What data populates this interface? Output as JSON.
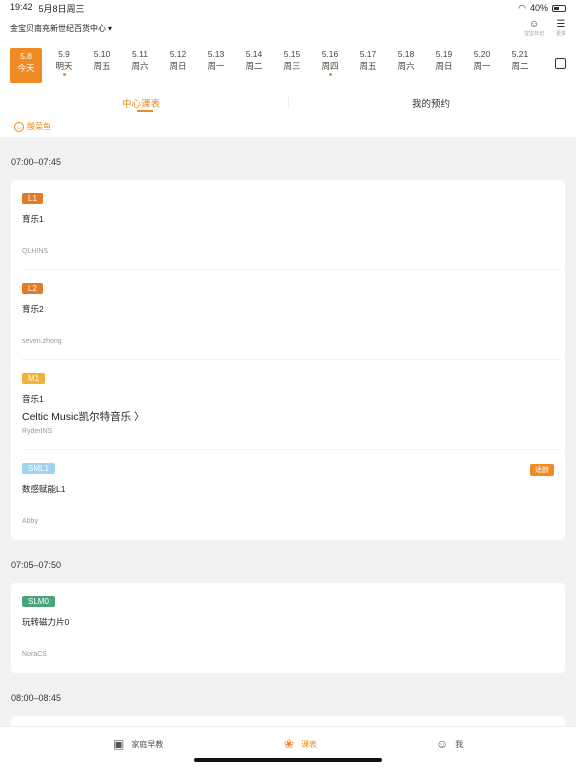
{
  "status": {
    "time": "19:42",
    "date": "5月8日周三",
    "battery": "40%"
  },
  "header": {
    "store": "金宝贝南充新世纪百货中心",
    "diary_label": "宝宝日记",
    "more_label": "更多"
  },
  "dates": [
    {
      "d": "5.8",
      "w": "今天",
      "active": true,
      "dot": false
    },
    {
      "d": "5.9",
      "w": "明天",
      "dot": true
    },
    {
      "d": "5.10",
      "w": "周五"
    },
    {
      "d": "5.11",
      "w": "周六"
    },
    {
      "d": "5.12",
      "w": "周日"
    },
    {
      "d": "5.13",
      "w": "周一"
    },
    {
      "d": "5.14",
      "w": "周二"
    },
    {
      "d": "5.15",
      "w": "周三"
    },
    {
      "d": "5.16",
      "w": "周四",
      "dot": true
    },
    {
      "d": "5.17",
      "w": "周五"
    },
    {
      "d": "5.18",
      "w": "周六"
    },
    {
      "d": "5.19",
      "w": "周日"
    },
    {
      "d": "5.20",
      "w": "周一"
    },
    {
      "d": "5.21",
      "w": "周二"
    }
  ],
  "tabs": {
    "center": "中心课表",
    "mine": "我的预约"
  },
  "filter": {
    "child": "酸菜鱼"
  },
  "sections": [
    {
      "time": "07:00–07:45",
      "classes": [
        {
          "badge": "L1",
          "color": "#e07b2a",
          "name": "育乐1",
          "subtitle": "",
          "teacher": "QLHINS",
          "tag": ""
        },
        {
          "badge": "L2",
          "color": "#e07b2a",
          "name": "育乐2",
          "subtitle": "",
          "teacher": "seven.zhong",
          "tag": ""
        },
        {
          "badge": "M1",
          "color": "#f0b33a",
          "name": "音乐1",
          "subtitle": "Celtic Music凯尔特音乐 〉",
          "teacher": "RyderINS",
          "tag": ""
        },
        {
          "badge": "SML1",
          "color": "#9fd3ee",
          "name": "数感赋能L1",
          "subtitle": "",
          "teacher": "Abby",
          "tag": "适龄"
        }
      ]
    },
    {
      "time": "07:05–07:50",
      "classes": [
        {
          "badge": "SLM0",
          "color": "#4aa37c",
          "name": "玩转磁力片0",
          "subtitle": "",
          "teacher": "NoraCS",
          "tag": ""
        }
      ]
    },
    {
      "time": "08:00–08:45",
      "classes": []
    }
  ],
  "nav": {
    "early": "家庭早教",
    "schedule": "课表",
    "me": "我"
  }
}
